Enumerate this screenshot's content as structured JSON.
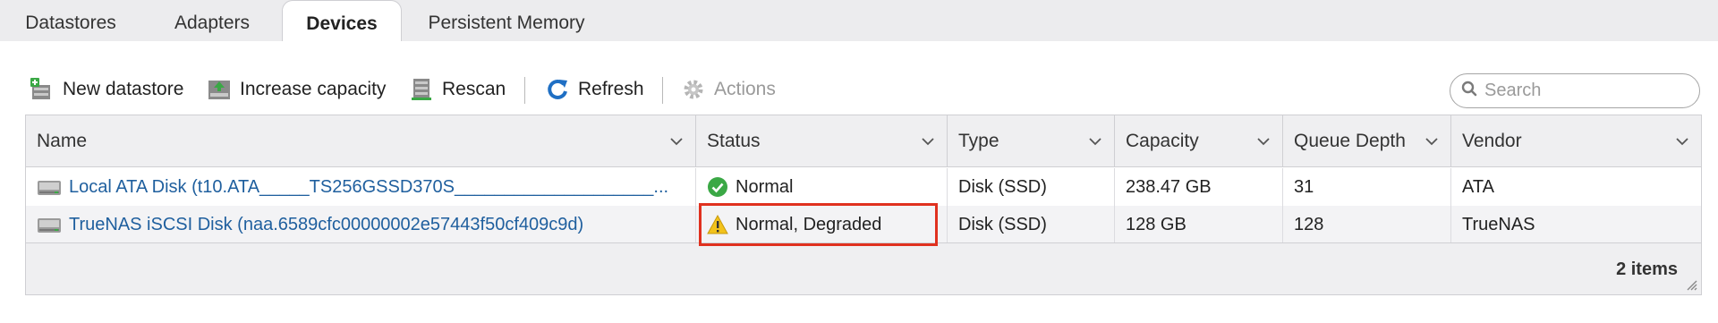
{
  "tabs": [
    "Datastores",
    "Adapters",
    "Devices",
    "Persistent Memory"
  ],
  "active_tab": "Devices",
  "toolbar": {
    "new_datastore": "New datastore",
    "increase_capacity": "Increase capacity",
    "rescan": "Rescan",
    "refresh": "Refresh",
    "actions": "Actions"
  },
  "search": {
    "placeholder": "Search",
    "value": ""
  },
  "table": {
    "columns": [
      "Name",
      "Status",
      "Type",
      "Capacity",
      "Queue Depth",
      "Vendor"
    ],
    "rows": [
      {
        "name": "Local ATA Disk (t10.ATA_____TS256GSSD370S____________________...",
        "status": "Normal",
        "status_kind": "ok",
        "type": "Disk (SSD)",
        "capacity": "238.47 GB",
        "queue_depth": "31",
        "vendor": "ATA"
      },
      {
        "name": "TrueNAS iSCSI Disk (naa.6589cfc00000002e57443f50cf409c9d)",
        "status": "Normal, Degraded",
        "status_kind": "warning",
        "type": "Disk (SSD)",
        "capacity": "128 GB",
        "queue_depth": "128",
        "vendor": "TrueNAS"
      }
    ],
    "footer_count": "2 items"
  },
  "icons": {
    "new_datastore": "add-datastore-icon",
    "increase_capacity": "increase-capacity-icon",
    "rescan": "rescan-icon",
    "refresh": "refresh-icon",
    "actions": "gear-icon",
    "search": "search-icon",
    "disk": "disk-icon",
    "status_ok": "check-circle-icon",
    "status_warning": "warning-triangle-icon"
  },
  "colors": {
    "link": "#1f5f9e",
    "ok": "#3aa845",
    "warning": "#f2c21b",
    "highlight": "#e0311f"
  }
}
